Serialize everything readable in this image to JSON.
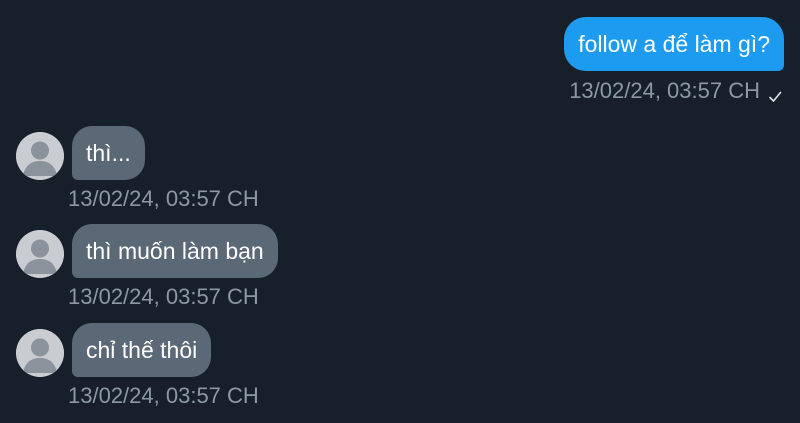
{
  "colors": {
    "background": "#17202a",
    "outgoing_bubble": "#1d9bf0",
    "incoming_bubble": "#5b6876",
    "meta_text": "#8b98a5",
    "avatar": "#c9ccd1"
  },
  "outgoing": {
    "text": "follow a để làm gì?",
    "timestamp": "13/02/24, 03:57 CH",
    "status_icon": "check-icon"
  },
  "incoming": [
    {
      "text": "thì...",
      "timestamp": "13/02/24, 03:57 CH",
      "avatar_icon": "default-user-avatar"
    },
    {
      "text": "thì muốn làm bạn",
      "timestamp": "13/02/24, 03:57 CH",
      "avatar_icon": "default-user-avatar"
    },
    {
      "text": "chỉ thế thôi",
      "timestamp": "13/02/24, 03:57 CH",
      "avatar_icon": "default-user-avatar"
    }
  ]
}
